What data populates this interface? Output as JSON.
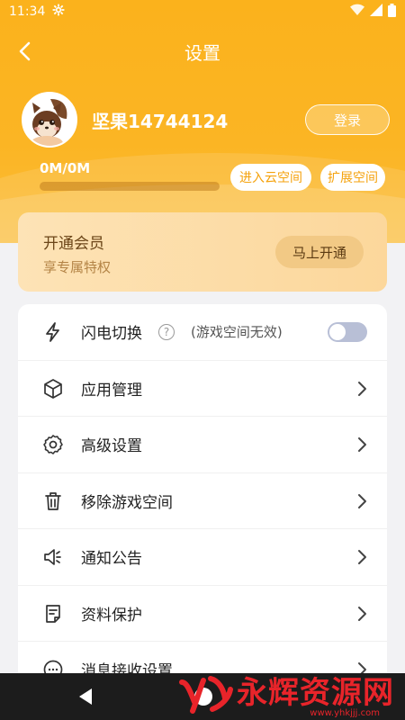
{
  "statusbar": {
    "time": "11:34"
  },
  "header": {
    "title": "设置"
  },
  "profile": {
    "username": "坚果14744124",
    "login_label": "登录"
  },
  "storage": {
    "text": "0M/0M",
    "used_fraction": 0.0,
    "cloud_label": "进入云空间",
    "expand_label": "扩展空间"
  },
  "vip": {
    "title": "开通会员",
    "subtitle": "享专属特权",
    "button": "马上开通"
  },
  "menu": {
    "flash_switch": {
      "label": "闪电切换",
      "help": "?",
      "note": "(游戏空间无效)",
      "enabled": false
    },
    "items": [
      {
        "label": "应用管理",
        "icon": "cube-icon"
      },
      {
        "label": "高级设置",
        "icon": "gear-icon"
      },
      {
        "label": "移除游戏空间",
        "icon": "trash-icon"
      },
      {
        "label": "通知公告",
        "icon": "speaker-icon"
      },
      {
        "label": "资料保护",
        "icon": "document-icon"
      },
      {
        "label": "消息接收设置",
        "icon": "chat-icon"
      }
    ]
  },
  "watermark": {
    "text": "永辉资源网",
    "url": "www.yhkjjj.com"
  },
  "colors": {
    "accent": "#fbb21c",
    "vip_bg": "#fde3b6",
    "toggle_off": "#b8bfd6"
  }
}
